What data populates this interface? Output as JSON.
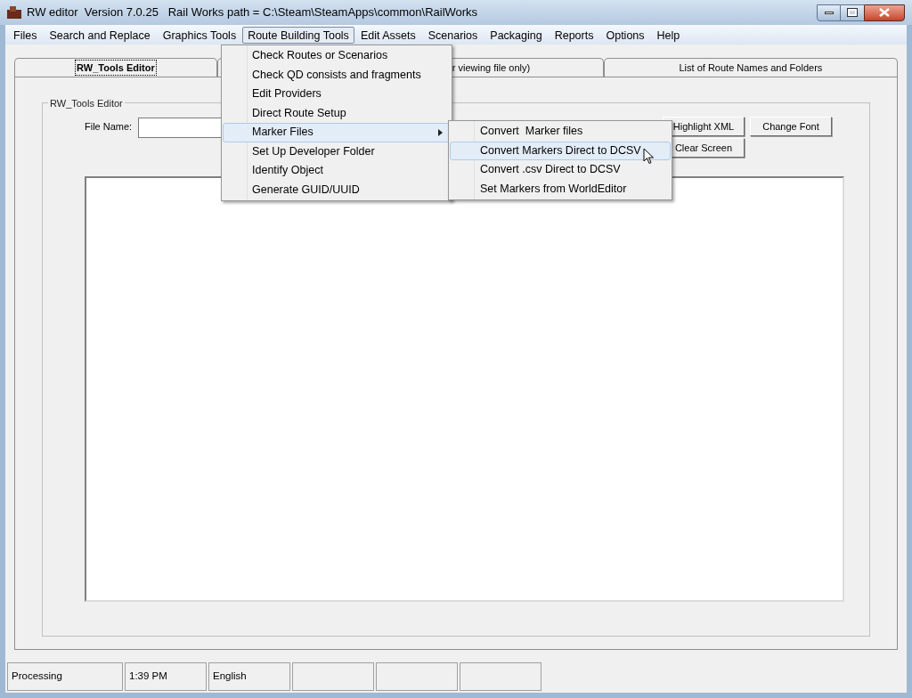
{
  "window": {
    "title": "RW editor  Version 7.0.25   Rail Works path = C:\\Steam\\SteamApps\\common\\RailWorks"
  },
  "menu_bar": [
    {
      "label": "Files",
      "selected": false
    },
    {
      "label": "Search and Replace",
      "selected": false
    },
    {
      "label": "Graphics Tools",
      "selected": false
    },
    {
      "label": "Route Building Tools",
      "selected": true
    },
    {
      "label": "Edit Assets",
      "selected": false
    },
    {
      "label": "Scenarios",
      "selected": false
    },
    {
      "label": "Packaging",
      "selected": false
    },
    {
      "label": "Reports",
      "selected": false
    },
    {
      "label": "Options",
      "selected": false
    },
    {
      "label": "Help",
      "selected": false
    }
  ],
  "dropdown": [
    {
      "label": "Check Routes or Scenarios",
      "selected": false,
      "has_submenu": false
    },
    {
      "label": "Check QD consists and fragments",
      "selected": false,
      "has_submenu": false
    },
    {
      "label": "Edit Providers",
      "selected": false,
      "has_submenu": false
    },
    {
      "label": "Direct Route Setup",
      "selected": false,
      "has_submenu": false
    },
    {
      "label": "Marker Files",
      "selected": true,
      "has_submenu": true
    },
    {
      "label": "Set Up Developer Folder",
      "selected": false,
      "has_submenu": false
    },
    {
      "label": "Identify Object",
      "selected": false,
      "has_submenu": false
    },
    {
      "label": "Generate GUID/UUID",
      "selected": false,
      "has_submenu": false
    }
  ],
  "submenu": [
    {
      "label": "Convert  Marker files",
      "selected": false
    },
    {
      "label": "Convert Markers Direct to DCSV",
      "selected": true
    },
    {
      "label": "Convert .csv Direct to DCSV",
      "selected": false
    },
    {
      "label": "Set Markers from WorldEditor",
      "selected": false
    }
  ],
  "tabs": [
    {
      "label": "RW_Tools Editor",
      "selected": true
    },
    {
      "label": "r viewing file only)",
      "selected": false
    },
    {
      "label": "List of Route Names and Folders",
      "selected": false
    }
  ],
  "editor": {
    "group_title": "RW_Tools Editor",
    "file_name_label": "File Name:",
    "buttons": [
      "Highlight XML",
      "Change Font",
      "Clear Screen"
    ]
  },
  "status_bar": [
    "Processing",
    "1:39 PM",
    "English"
  ]
}
